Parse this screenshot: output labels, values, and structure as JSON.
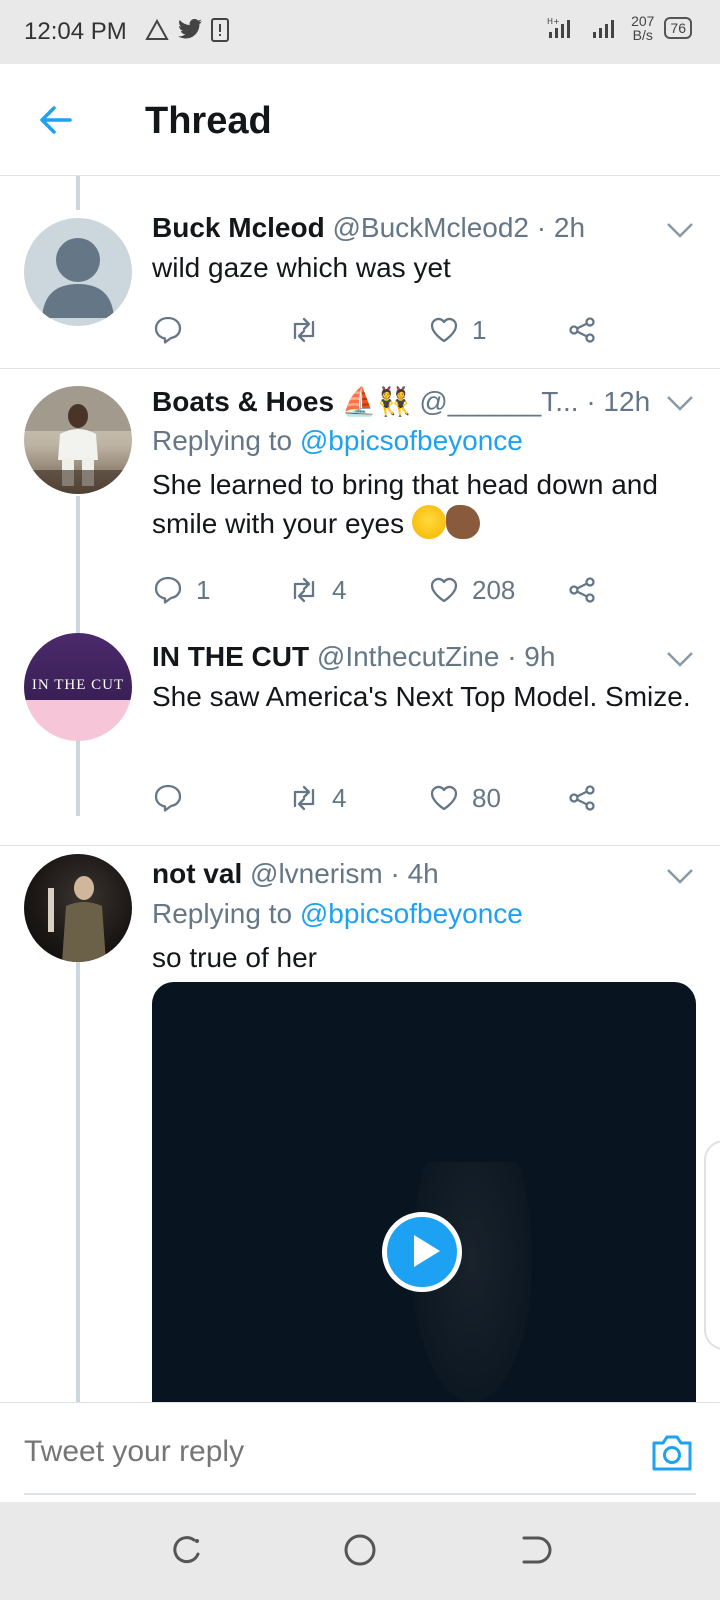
{
  "status_bar": {
    "time": "12:04 PM",
    "speed_value": "207",
    "speed_unit": "B/s",
    "battery": "76"
  },
  "header": {
    "title": "Thread"
  },
  "tweets": [
    {
      "name": "Buck Mcleod",
      "handle": "@BuckMcleod2",
      "time": "· 2h",
      "text": "wild gaze which was yet",
      "replies": "",
      "retweets": "",
      "likes": "1"
    },
    {
      "name": "Boats & Hoes",
      "name_emoji": "⛵👯",
      "handle": "@______T...",
      "time": "· 12h",
      "replying_prefix": "Replying to",
      "replying_handle": "@bpicsofbeyonce",
      "text": "She learned to bring that head down and smile with your eyes",
      "replies": "1",
      "retweets": "4",
      "likes": "208"
    },
    {
      "name": "IN THE CUT",
      "handle": "@InthecutZine",
      "time": "· 9h",
      "avatar_text": "IN THE CUT",
      "text": "She saw America's Next Top Model. Smize.",
      "replies": "",
      "retweets": "4",
      "likes": "80"
    },
    {
      "name": "not val",
      "handle": "@lvnerism",
      "time": "· 4h",
      "replying_prefix": "Replying to",
      "replying_handle": "@bpicsofbeyonce",
      "text": "so true of her"
    }
  ],
  "reply_bar": {
    "placeholder": "Tweet your reply"
  },
  "colors": {
    "accent": "#1da1f2",
    "text": "#14171a",
    "muted": "#657786",
    "divider": "#dfe3e6"
  }
}
